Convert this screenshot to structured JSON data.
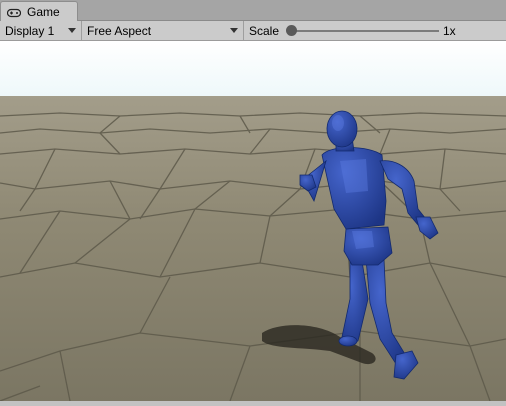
{
  "window": {
    "tab_label": "Game",
    "tab_icon": "gamepad-icon"
  },
  "toolbar": {
    "display_label": "Display 1",
    "aspect_label": "Free Aspect",
    "scale_label": "Scale",
    "scale_value": "1x",
    "scale_slider_position": 0.0
  },
  "scene": {
    "sky_color": "#f3fbfd",
    "ground_color": "#8a8470",
    "character_color": "#2a4aa8"
  }
}
